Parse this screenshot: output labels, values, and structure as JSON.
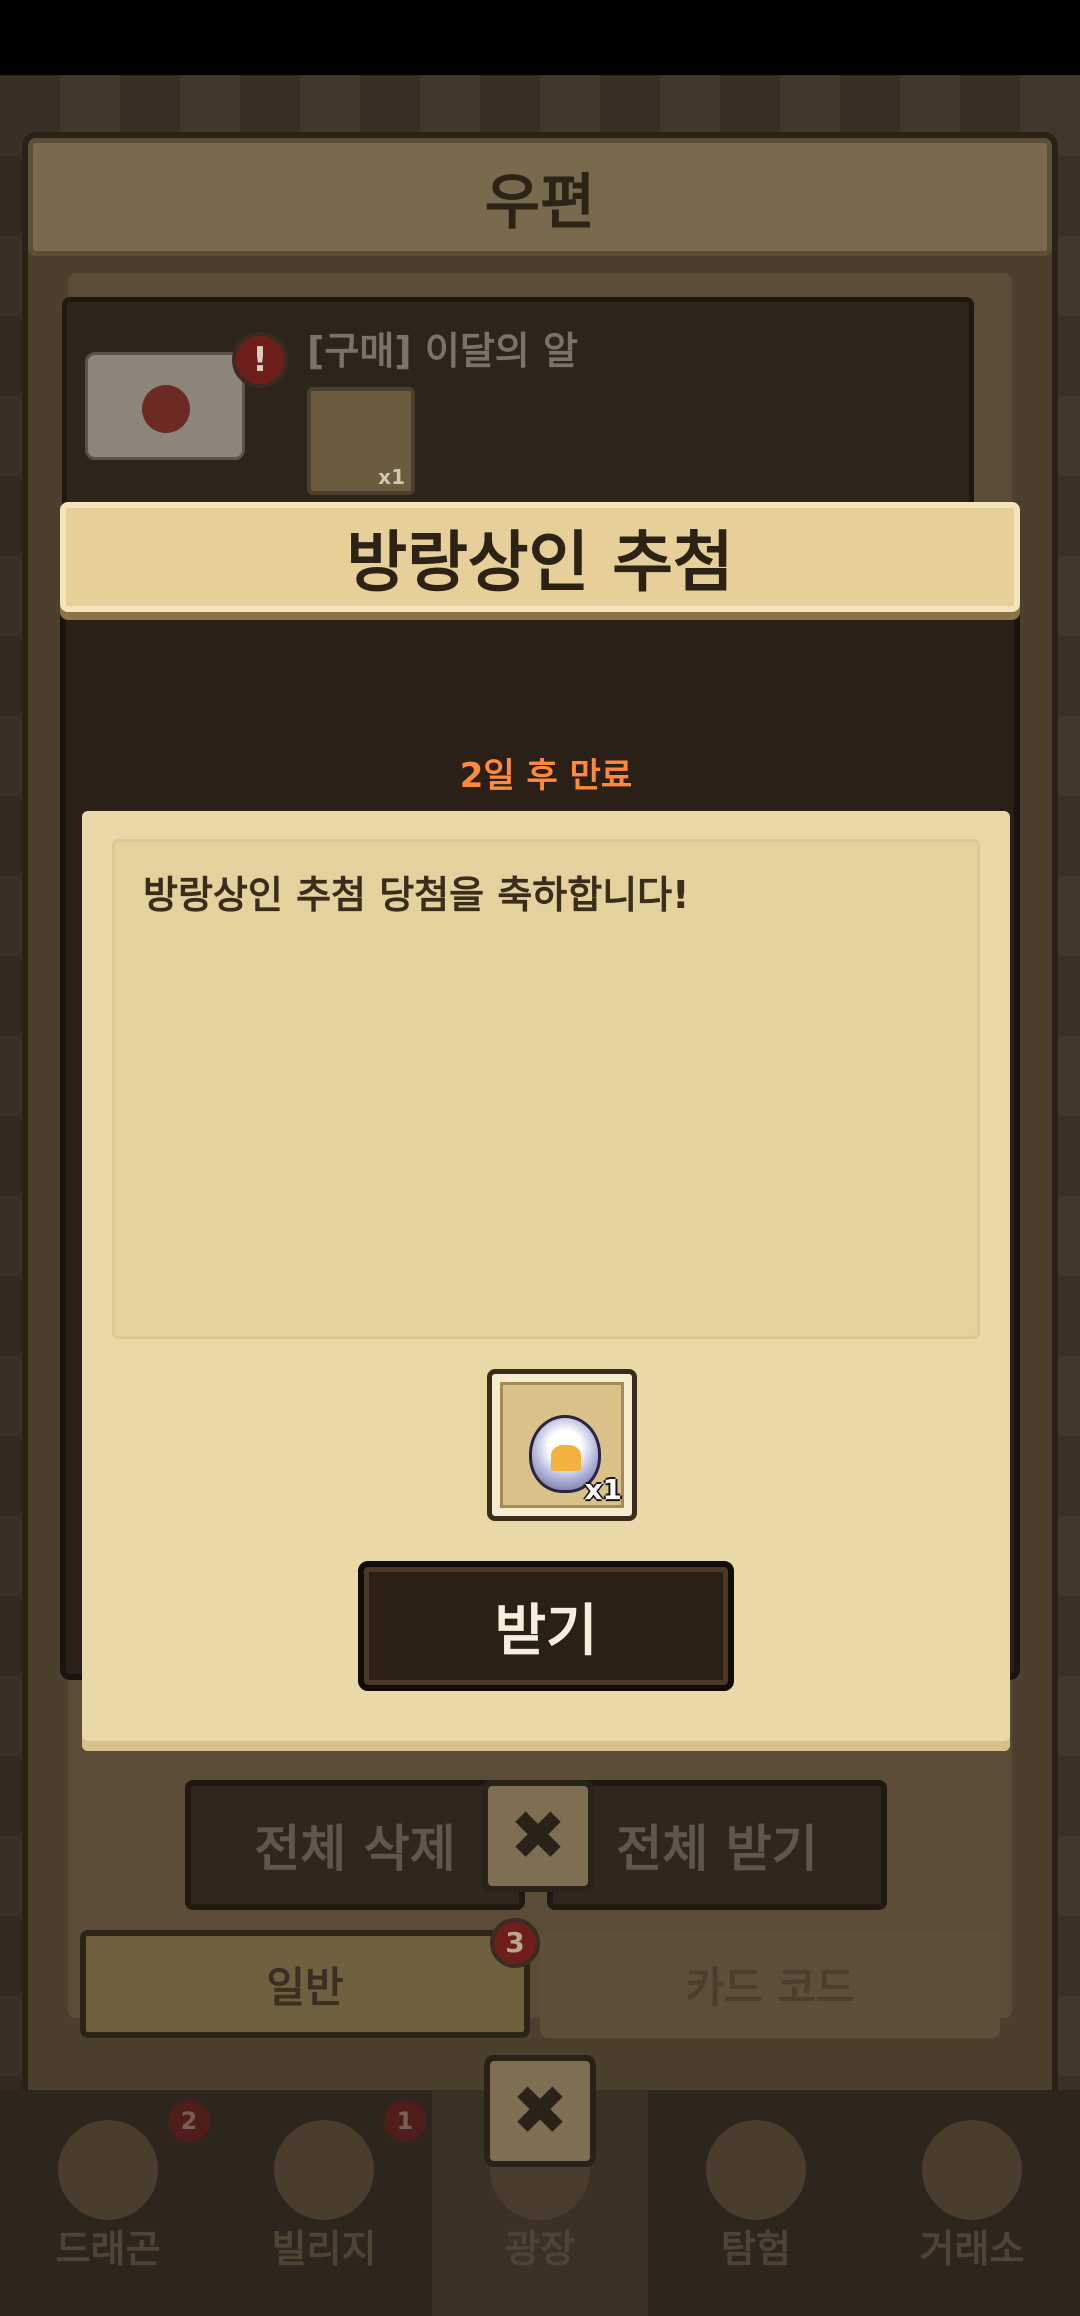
{
  "mail_window": {
    "title": "우편",
    "item": {
      "title": "[구매] 이달의 알",
      "alert_symbol": "!",
      "thumb_qty": "x1"
    },
    "bulk_delete_label": "전체 삭제",
    "bulk_receive_label": "전체 받기",
    "close_symbol": "✖",
    "tabs": [
      {
        "label": "일반",
        "badge": "3"
      },
      {
        "label": "카드 코드"
      }
    ]
  },
  "bottom_nav": {
    "items": [
      {
        "label": "드래곤",
        "badge": "2",
        "icon": "dragon-icon"
      },
      {
        "label": "빌리지",
        "badge": "1",
        "icon": "village-icon"
      },
      {
        "label": "광장",
        "icon": "plaza-icon"
      },
      {
        "label": "탐험",
        "icon": "compass-icon"
      },
      {
        "label": "거래소",
        "icon": "merchant-icon"
      }
    ],
    "close_symbol": "✖"
  },
  "modal": {
    "title": "방랑상인 추첨",
    "expiry": "2일 후 만료",
    "message": "방랑상인 추첨 당첨을 축하합니다!",
    "reward": {
      "icon": "egg-icon",
      "qty": "x1"
    },
    "claim_label": "받기"
  },
  "colors": {
    "expiry_text": "#ff8a3c",
    "header_bg": "#e6cf98",
    "paper_bg": "#e9d9a8",
    "button_bg": "#2c1f14"
  }
}
